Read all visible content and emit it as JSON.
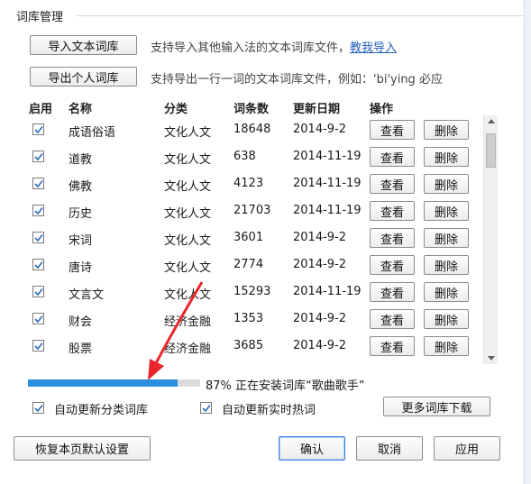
{
  "section": {
    "title": "词库管理"
  },
  "import_text": {
    "button": "导入文本词库",
    "desc": "支持导入其他输入法的文本词库文件，",
    "link": "教我导入"
  },
  "export_personal": {
    "button": "导出个人词库",
    "desc": "支持导出一行一词的文本词库文件，例如：'bi'ying 必应"
  },
  "table": {
    "headers": [
      "启用",
      "名称",
      "分类",
      "词条数",
      "更新日期",
      "操作"
    ],
    "view_label": "查看",
    "delete_label": "删除",
    "rows": [
      {
        "enabled": true,
        "name": "成语俗语",
        "category": "文化人文",
        "count": "18648",
        "date": "2014-9-2"
      },
      {
        "enabled": true,
        "name": "道教",
        "category": "文化人文",
        "count": "638",
        "date": "2014-11-19"
      },
      {
        "enabled": true,
        "name": "佛教",
        "category": "文化人文",
        "count": "4123",
        "date": "2014-11-19"
      },
      {
        "enabled": true,
        "name": "历史",
        "category": "文化人文",
        "count": "21703",
        "date": "2014-11-19"
      },
      {
        "enabled": true,
        "name": "宋词",
        "category": "文化人文",
        "count": "3601",
        "date": "2014-9-2"
      },
      {
        "enabled": true,
        "name": "唐诗",
        "category": "文化人文",
        "count": "2774",
        "date": "2014-9-2"
      },
      {
        "enabled": true,
        "name": "文言文",
        "category": "文化人文",
        "count": "15293",
        "date": "2014-11-19"
      },
      {
        "enabled": true,
        "name": "财会",
        "category": "经济金融",
        "count": "1353",
        "date": "2014-9-2"
      },
      {
        "enabled": true,
        "name": "股票",
        "category": "经济金融",
        "count": "3685",
        "date": "2014-9-2"
      }
    ]
  },
  "progress": {
    "value": 0.87,
    "label": "87%  正在安装词库“歌曲歌手”",
    "color": "#2b8fe0"
  },
  "options": {
    "auto_update_category": "自动更新分类词库",
    "auto_update_hotwords": "自动更新实时热词",
    "more_download": "更多词库下载"
  },
  "footer": {
    "restore_default": "恢复本页默认设置",
    "ok": "确认",
    "cancel": "取消",
    "apply": "应用"
  },
  "colors": {
    "link": "#1f5fb8",
    "annotation_arrow": "#e8262b"
  },
  "icons": {
    "checkbox": "check-icon",
    "annotation": "red-arrow-icon"
  }
}
